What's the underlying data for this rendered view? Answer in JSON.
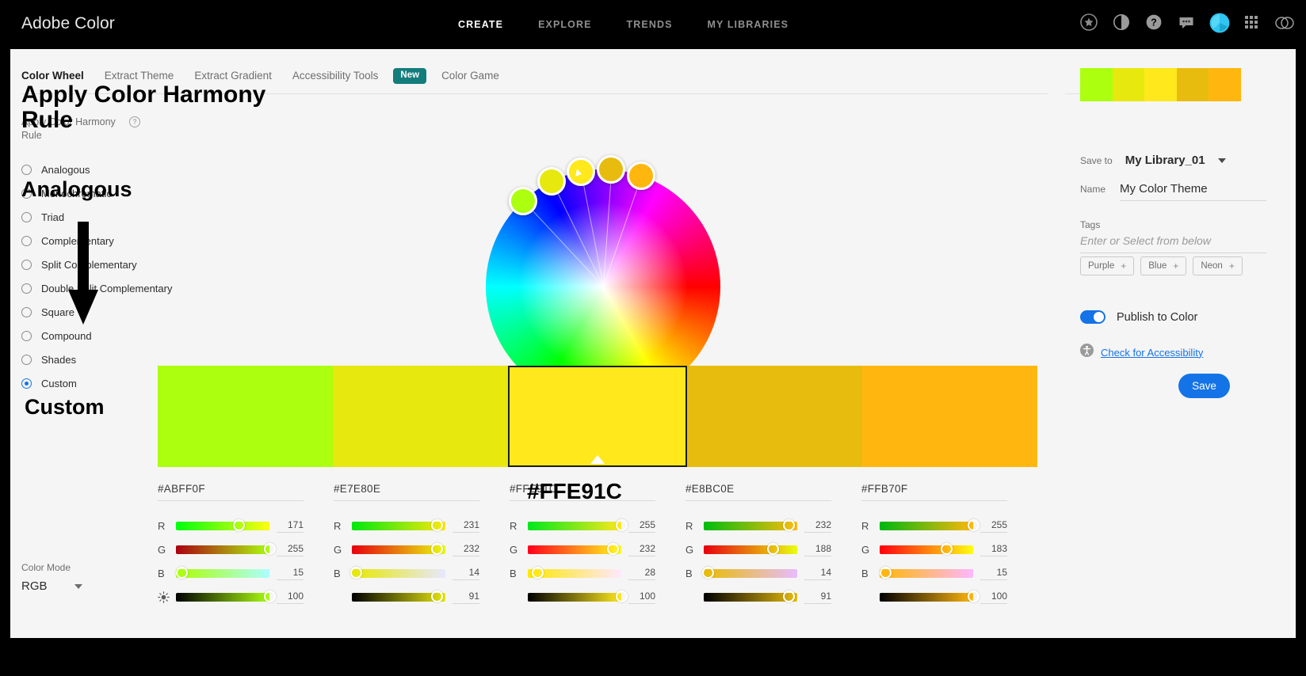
{
  "app": {
    "brand": "Adobe Color"
  },
  "topnav": {
    "items": [
      {
        "label": "CREATE",
        "active": true
      },
      {
        "label": "EXPLORE",
        "active": false
      },
      {
        "label": "TRENDS",
        "active": false
      },
      {
        "label": "MY LIBRARIES",
        "active": false
      }
    ],
    "icons": [
      "star-badge-icon",
      "contrast-icon",
      "help-icon",
      "feedback-icon",
      "avatar-icon",
      "app-grid-icon",
      "creative-cloud-icon"
    ]
  },
  "tooltabs": {
    "items": [
      {
        "label": "Color Wheel",
        "active": true
      },
      {
        "label": "Extract Theme",
        "active": false
      },
      {
        "label": "Extract Gradient",
        "active": false
      },
      {
        "label": "Accessibility Tools",
        "active": false
      },
      {
        "label": "Color Game",
        "active": false
      }
    ],
    "new_badge": "New"
  },
  "harmony": {
    "heading": "Apply Color Harmony Rule",
    "help_glyph": "?",
    "rules": [
      {
        "label": "Analogous",
        "selected": false
      },
      {
        "label": "Monochromatic",
        "selected": false
      },
      {
        "label": "Triad",
        "selected": false
      },
      {
        "label": "Complementary",
        "selected": false
      },
      {
        "label": "Split Complementary",
        "selected": false
      },
      {
        "label": "Double Split Complementary",
        "selected": false
      },
      {
        "label": "Square",
        "selected": false
      },
      {
        "label": "Compound",
        "selected": false
      },
      {
        "label": "Shades",
        "selected": false
      },
      {
        "label": "Custom",
        "selected": true
      }
    ]
  },
  "color_mode": {
    "label": "Color Mode",
    "value": "RGB"
  },
  "swatches": [
    {
      "hex": "#ABFF0F",
      "css": "#ABFF0F",
      "selected": false,
      "channels": [
        {
          "name": "R",
          "value": "171",
          "pct": 67
        },
        {
          "name": "G",
          "value": "255",
          "pct": 100
        },
        {
          "name": "B",
          "value": "15",
          "pct": 6
        }
      ],
      "brightness": {
        "value": "100",
        "pct": 100
      }
    },
    {
      "hex": "#E7E80E",
      "css": "#E7E80E",
      "selected": false,
      "channels": [
        {
          "name": "R",
          "value": "231",
          "pct": 91
        },
        {
          "name": "G",
          "value": "232",
          "pct": 91
        },
        {
          "name": "B",
          "value": "14",
          "pct": 5
        }
      ],
      "brightness": {
        "value": "91",
        "pct": 91
      }
    },
    {
      "hex": "#FFE91C",
      "css": "#FFE81C",
      "selected": true,
      "channels": [
        {
          "name": "R",
          "value": "255",
          "pct": 100
        },
        {
          "name": "G",
          "value": "232",
          "pct": 91
        },
        {
          "name": "B",
          "value": "28",
          "pct": 11
        }
      ],
      "brightness": {
        "value": "100",
        "pct": 100
      }
    },
    {
      "hex": "#E8BC0E",
      "css": "#E8BC0E",
      "selected": false,
      "channels": [
        {
          "name": "R",
          "value": "232",
          "pct": 91
        },
        {
          "name": "G",
          "value": "188",
          "pct": 74
        },
        {
          "name": "B",
          "value": "14",
          "pct": 5
        }
      ],
      "brightness": {
        "value": "91",
        "pct": 91
      }
    },
    {
      "hex": "#FFB70F",
      "css": "#FFB70F",
      "selected": false,
      "channels": [
        {
          "name": "R",
          "value": "255",
          "pct": 100
        },
        {
          "name": "G",
          "value": "183",
          "pct": 72
        },
        {
          "name": "B",
          "value": "15",
          "pct": 6
        }
      ],
      "brightness": {
        "value": "100",
        "pct": 100
      }
    }
  ],
  "save_panel": {
    "save_to_label": "Save to",
    "save_to_value": "My Library_01",
    "name_label": "Name",
    "name_value": "My Color Theme",
    "tags_label": "Tags",
    "tags_placeholder": "Enter or Select from below",
    "tag_chips": [
      {
        "label": "Purple",
        "plus": "+"
      },
      {
        "label": "Blue",
        "plus": "+"
      },
      {
        "label": "Neon",
        "plus": "+"
      }
    ],
    "publish_label": "Publish to Color",
    "publish_on": true,
    "accessibility_link": "Check for Accessibility",
    "save_button": "Save",
    "accent_color": "#1473E6"
  },
  "annotations": {
    "apply_rule": "Apply Color Harmony\nRule",
    "analogous": "Analogous",
    "custom": "Custom",
    "hex": "#FFE91C"
  }
}
